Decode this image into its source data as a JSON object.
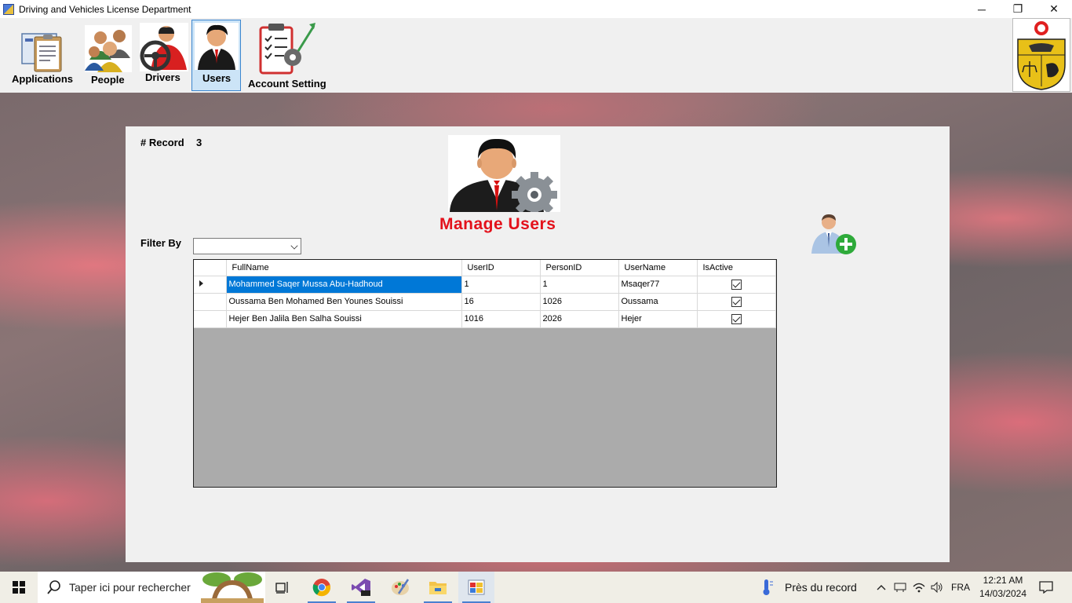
{
  "window": {
    "title": "Driving and Vehicles License Department",
    "controls": {
      "minimize": "─",
      "maximize": "❐",
      "close": "✕"
    }
  },
  "toolbar": {
    "items": [
      {
        "label": "Applications",
        "icon": "applications-clipboard-icon",
        "active": false
      },
      {
        "label": "People",
        "icon": "people-group-icon",
        "active": false
      },
      {
        "label": "Drivers",
        "icon": "driver-steering-wheel-icon",
        "active": false
      },
      {
        "label": "Users",
        "icon": "user-businessman-icon",
        "active": true
      },
      {
        "label": "Account Setting",
        "icon": "account-settings-checklist-icon",
        "active": false
      }
    ],
    "emblem": "tunisia-coat-of-arms-icon"
  },
  "panel": {
    "record_label": "# Record",
    "record_count": "3",
    "title": "Manage Users",
    "title_color": "#e3111b",
    "filter_label": "Filter By",
    "filter_value": "",
    "add_user_icon": "add-user-icon"
  },
  "grid": {
    "columns": [
      "FullName",
      "UserID",
      "PersonID",
      "UserName",
      "IsActive"
    ],
    "rows": [
      {
        "full_name": "Mohammed Saqer Mussa Abu-Hadhoud",
        "user_id": "1",
        "person_id": "1",
        "user_name": "Msaqer77",
        "is_active": true,
        "selected": true
      },
      {
        "full_name": "Oussama Ben Mohamed Ben Younes Souissi",
        "user_id": "16",
        "person_id": "1026",
        "user_name": "Oussama",
        "is_active": true,
        "selected": false
      },
      {
        "full_name": "Hejer Ben Jalila Ben Salha Souissi",
        "user_id": "1016",
        "person_id": "2026",
        "user_name": "Hejer",
        "is_active": true,
        "selected": false
      }
    ],
    "selection_color": "#0078d7"
  },
  "taskbar": {
    "search_placeholder": "Taper ici pour rechercher",
    "weather_text": "Près du record",
    "language": "FRA",
    "time": "12:21 AM",
    "date": "14/03/2024",
    "apps": [
      "chrome-icon",
      "visual-studio-preview-icon",
      "paint-icon",
      "file-explorer-icon",
      "winforms-app-icon"
    ]
  }
}
